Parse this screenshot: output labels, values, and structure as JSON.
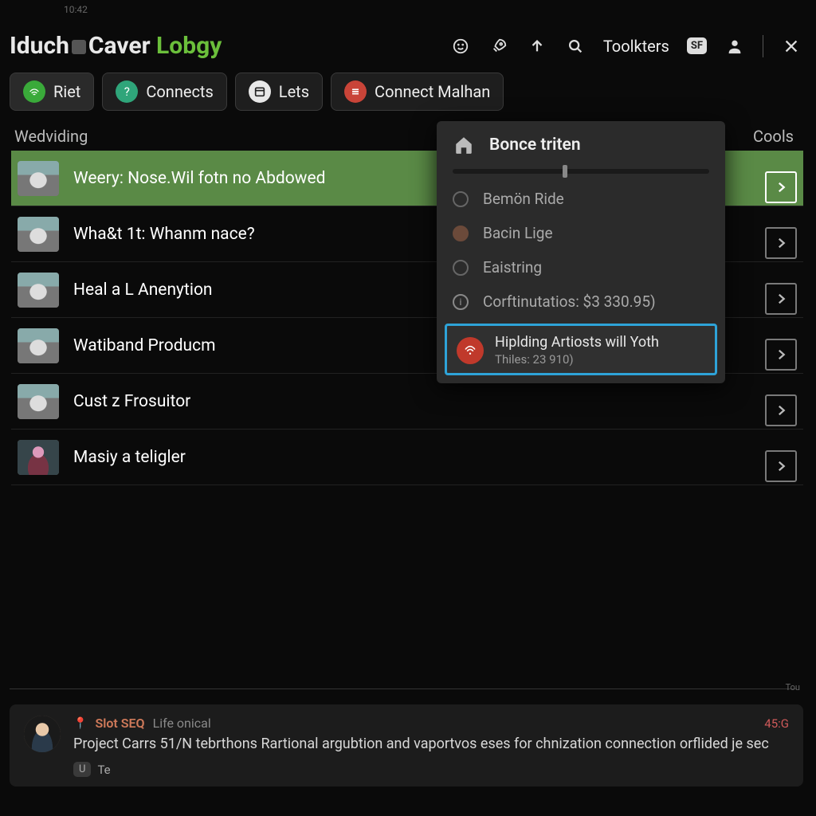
{
  "status_time": "10:42",
  "header": {
    "brand": "Iduch",
    "icon_label": "gear",
    "brand2": "Caver",
    "lobby": "Lobgy",
    "toolkters": "Toolkters",
    "badge": "SF"
  },
  "tabs": [
    {
      "label": "Riet",
      "icon": "signal",
      "color": "green",
      "active": true
    },
    {
      "label": "Connects",
      "icon": "help",
      "color": "teal",
      "active": false
    },
    {
      "label": "Lets",
      "icon": "calendar",
      "color": "white",
      "active": false
    },
    {
      "label": "Connect Malhan",
      "icon": "menu",
      "color": "red",
      "active": false
    }
  ],
  "columns": {
    "left": "Wedviding",
    "right": "Cools"
  },
  "rows": [
    {
      "label": "Weery: Nose.Wil fotn no Abdowed",
      "thumb": "car",
      "selected": true
    },
    {
      "label": "Wha&t 1t: Whanm nace?",
      "thumb": "car",
      "selected": false
    },
    {
      "label": "Heal a L Anenytion",
      "thumb": "car",
      "selected": false
    },
    {
      "label": "Watiband Producm",
      "thumb": "car",
      "selected": false
    },
    {
      "label": "Cust z Frosuitor",
      "thumb": "car",
      "selected": false
    },
    {
      "label": "Masiy a teligler",
      "thumb": "person",
      "selected": false
    }
  ],
  "side_panel": {
    "title": "Bonce triten",
    "items": [
      {
        "kind": "dot",
        "label": "Bemön Ride"
      },
      {
        "kind": "dot-brown",
        "label": "Bacin Lige"
      },
      {
        "kind": "dot",
        "label": "Eaistring"
      },
      {
        "kind": "info",
        "label": "Corftinutatios: $3 330.95)"
      }
    ],
    "highlight": {
      "title": "Hiplding Artiosts will Yoth",
      "subtitle": "Thiles: 23 910)"
    }
  },
  "footer_tag": "Tou",
  "chat": {
    "username": "Slot SEQ",
    "meta": "Life onical",
    "timestamp": "45:G",
    "message": "Project Carrs 51/N tebrthons Rartional argubtion and vaportvos eses for chnization connection orflided je sec",
    "kbd": "U",
    "t": "Te"
  }
}
